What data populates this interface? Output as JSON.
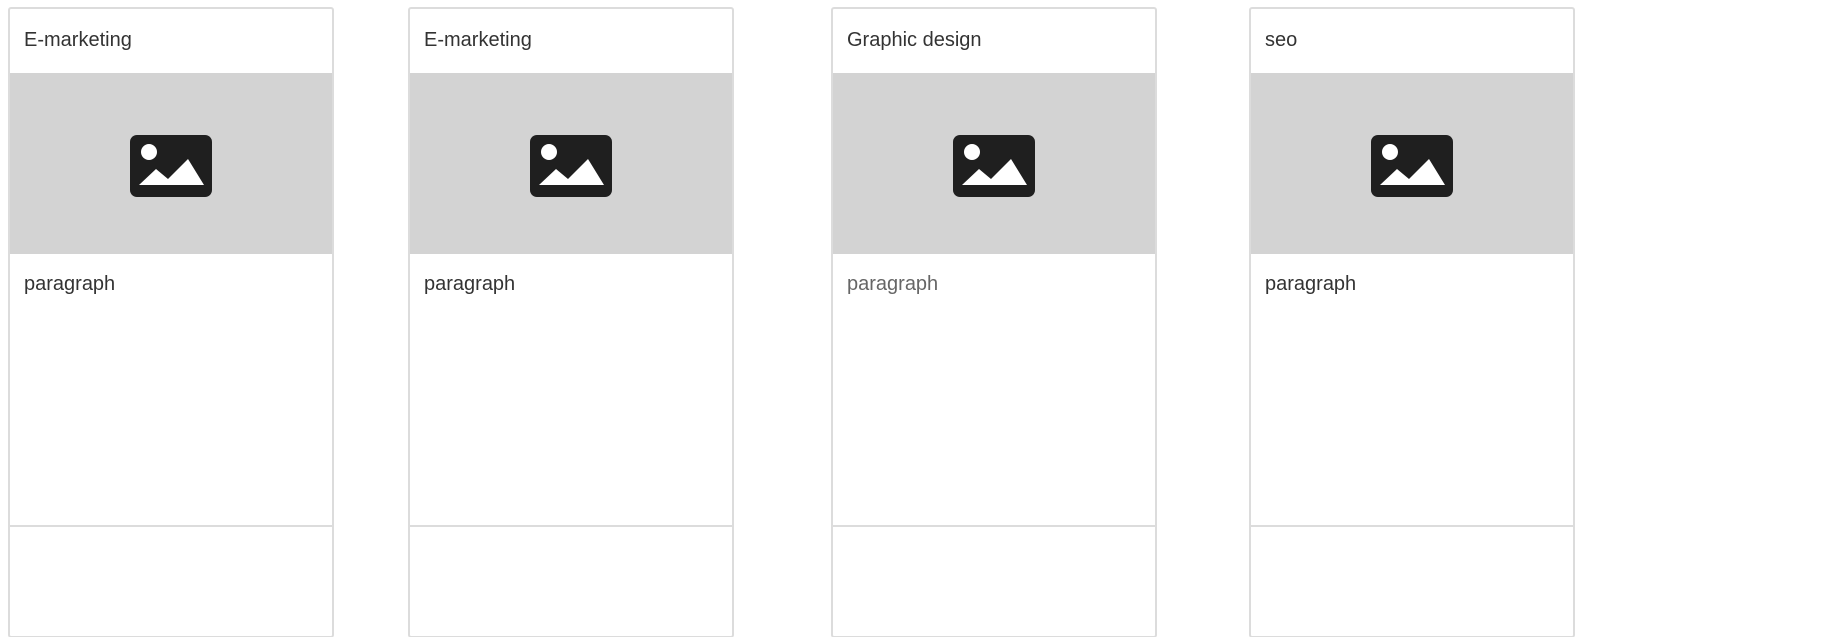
{
  "cards": [
    {
      "title": "E-marketing",
      "body": "paragraph",
      "image_icon": "image-placeholder-icon"
    },
    {
      "title": "E-marketing",
      "body": "paragraph",
      "image_icon": "image-placeholder-icon"
    },
    {
      "title": "Graphic design",
      "body": "paragraph",
      "image_icon": "image-placeholder-icon"
    },
    {
      "title": "seo",
      "body": "paragraph",
      "image_icon": "image-placeholder-icon"
    }
  ],
  "colors": {
    "image_bg": "#d3d3d3",
    "card_border": "#dcdcdc",
    "icon": "#1f1f1f"
  }
}
